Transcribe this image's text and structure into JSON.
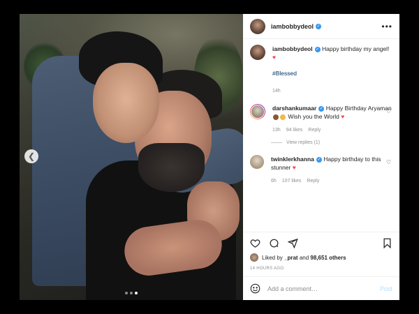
{
  "post": {
    "author": "iambobbydeol",
    "carousel": {
      "slides": 3,
      "active_index": 2
    }
  },
  "caption": {
    "username": "iambobbydeol",
    "text": "Happy birthday my angel!",
    "emoji": "♥",
    "hashtag": "#Blessed",
    "time": "14h"
  },
  "comments": [
    {
      "username": "darshankumaar",
      "text_part1": "Happy Birthday Aryaman",
      "text_part2": "Wish you the World",
      "time": "13h",
      "likes": "94 likes",
      "reply": "Reply",
      "view_replies": "View replies (1)"
    },
    {
      "username": "twinklerkhanna",
      "text": "Happy birthday to this stunner",
      "time": "6h",
      "likes": "107 likes",
      "reply": "Reply"
    }
  ],
  "actions": {
    "liked_by_prefix": "Liked by",
    "liked_by_user": "_prat",
    "liked_by_middle": "and",
    "liked_by_count": "98,651 others",
    "time_ago": "14 HOURS AGO"
  },
  "add_comment": {
    "placeholder": "Add a comment…",
    "post_label": "Post"
  },
  "colors": {
    "verified": "#3897f0",
    "heart_red": "#ed4956",
    "hashtag": "#00376b",
    "post_button_disabled": "#b2dffc"
  }
}
